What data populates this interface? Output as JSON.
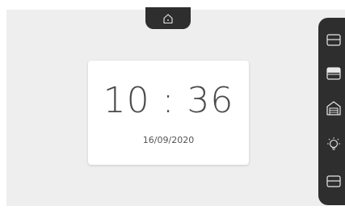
{
  "clock": {
    "time": "10 : 36",
    "date": "16/09/2020"
  },
  "top_tab": {
    "icon": "home-icon"
  },
  "side_panel": {
    "items": [
      {
        "icon": "cover-icon"
      },
      {
        "icon": "shutter-icon"
      },
      {
        "icon": "garage-icon"
      },
      {
        "icon": "light-bulb-icon"
      },
      {
        "icon": "cover-icon"
      }
    ]
  },
  "colors": {
    "background": "#eeeeee",
    "panel": "#2e2e2e",
    "card": "#ffffff",
    "icon": "#e8e8e8",
    "text": "#4a4a4a"
  }
}
